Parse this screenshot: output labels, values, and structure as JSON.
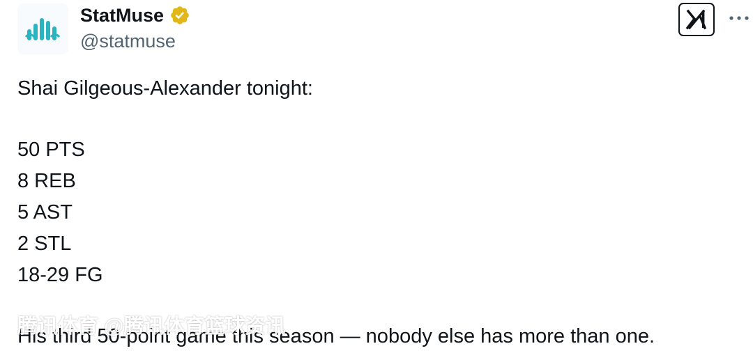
{
  "author": {
    "display_name": "StatMuse",
    "handle": "@statmuse",
    "verified_icon": "verified-badge-icon",
    "verified_color": "#e2b719",
    "avatar_color": "#2bb3c0"
  },
  "actions": {
    "grok_icon": "grok-icon",
    "more_icon": "more-icon"
  },
  "tweet": {
    "intro": "Shai Gilgeous-Alexander tonight:",
    "stats": [
      "50 PTS",
      "8 REB",
      "5 AST",
      "2 STL",
      "18-29 FG"
    ],
    "footer": "His third 50-point game this season — nobody else has more than one."
  },
  "watermark": "腾讯体育 @腾讯体育篮球资讯"
}
